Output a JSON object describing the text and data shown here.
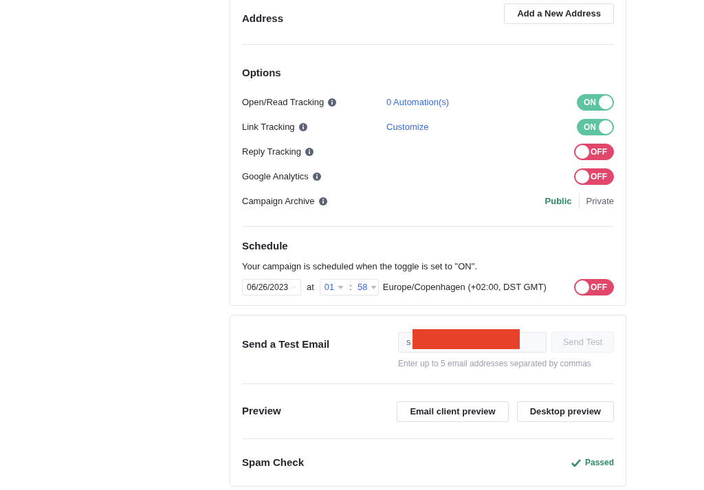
{
  "address": {
    "title": "Address",
    "button": "Add a New Address"
  },
  "options": {
    "title": "Options",
    "rows": [
      {
        "kind": "toggle",
        "label": "Open/Read Tracking",
        "link": "0 Automation(s)",
        "on": true,
        "on_text": "ON"
      },
      {
        "kind": "toggle",
        "label": "Link Tracking",
        "link": "Customize",
        "on": true,
        "on_text": "ON"
      },
      {
        "kind": "toggle",
        "label": "Reply Tracking",
        "on": false,
        "off_text": "OFF"
      },
      {
        "kind": "toggle",
        "label": "Google Analytics",
        "on": false,
        "off_text": "OFF"
      },
      {
        "kind": "segmented",
        "label": "Campaign Archive",
        "segments": [
          {
            "label": "Public",
            "selected": true
          },
          {
            "label": "Private",
            "selected": false
          }
        ]
      }
    ]
  },
  "schedule": {
    "title": "Schedule",
    "description": "Your campaign is scheduled when the toggle is set to \"ON\".",
    "date": "06/26/2023",
    "at": "at",
    "hour": "01",
    "separator": ":",
    "minute": "58",
    "timezone": "Europe/Copenhagen (+02:00, DST GMT)",
    "on": false,
    "off_text": "OFF"
  },
  "test_email": {
    "title": "Send a Test Email",
    "value": "s",
    "button": "Send Test",
    "button_disabled": true,
    "hint": "Enter up to 5 email addresses separated by commas"
  },
  "preview": {
    "title": "Preview",
    "buttons": [
      "Email client preview",
      "Desktop preview"
    ]
  },
  "spam_check": {
    "title": "Spam Check",
    "status": "Passed"
  }
}
